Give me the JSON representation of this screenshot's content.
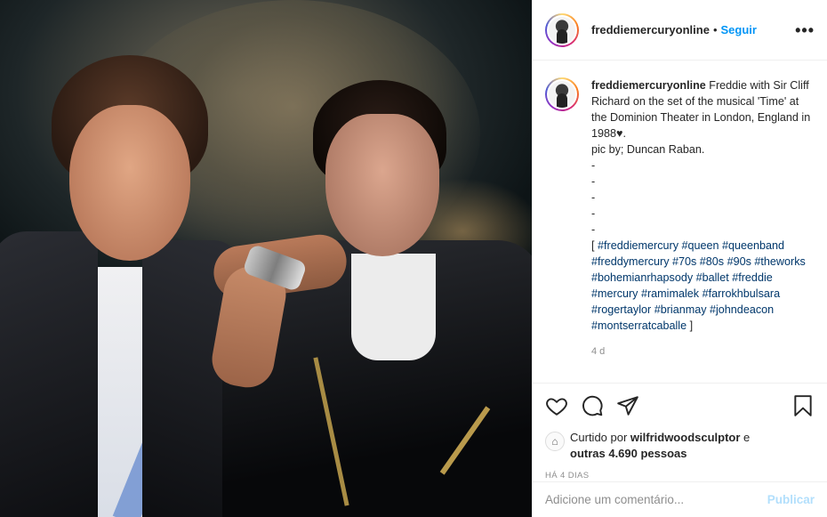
{
  "post": {
    "username": "freddiemercuryonline",
    "separator": "•",
    "follow_label": "Seguir",
    "more_icon": "more-options-icon",
    "caption_username": "freddiemercuryonline",
    "caption_text": " Freddie with Sir Cliff Richard on the set of the musical 'Time' at the Dominion Theater in London, England in 1988♥.\npic by; Duncan Raban.\n-\n-\n-\n-\n-\n[ ",
    "hashtags": "#freddiemercury #queen #queenband #freddymercury #70s #80s #90s #theworks #bohemianrhapsody #ballet #freddie #mercury #ramimalek #farrokhbulsara #rogertaylor #brianmay #johndeacon #montserratcaballe",
    "caption_end": " ]",
    "time_ago": "4 d"
  },
  "actions": {
    "like_icon": "heart-icon",
    "comment_icon": "comment-icon",
    "share_icon": "share-icon",
    "save_icon": "bookmark-icon"
  },
  "likes": {
    "prefix": "Curtido por ",
    "liker": "wilfridwoodsculptor",
    "middle": " e",
    "others": "outras 4.690 pessoas",
    "date_label": "HÁ 4 DIAS"
  },
  "comment": {
    "placeholder": "Adicione um comentário...",
    "post_label": "Publicar"
  },
  "colors": {
    "link": "#0095f6",
    "hashtag": "#00376b",
    "muted": "#8e8e8e",
    "post_disabled": "#b2dffc"
  }
}
